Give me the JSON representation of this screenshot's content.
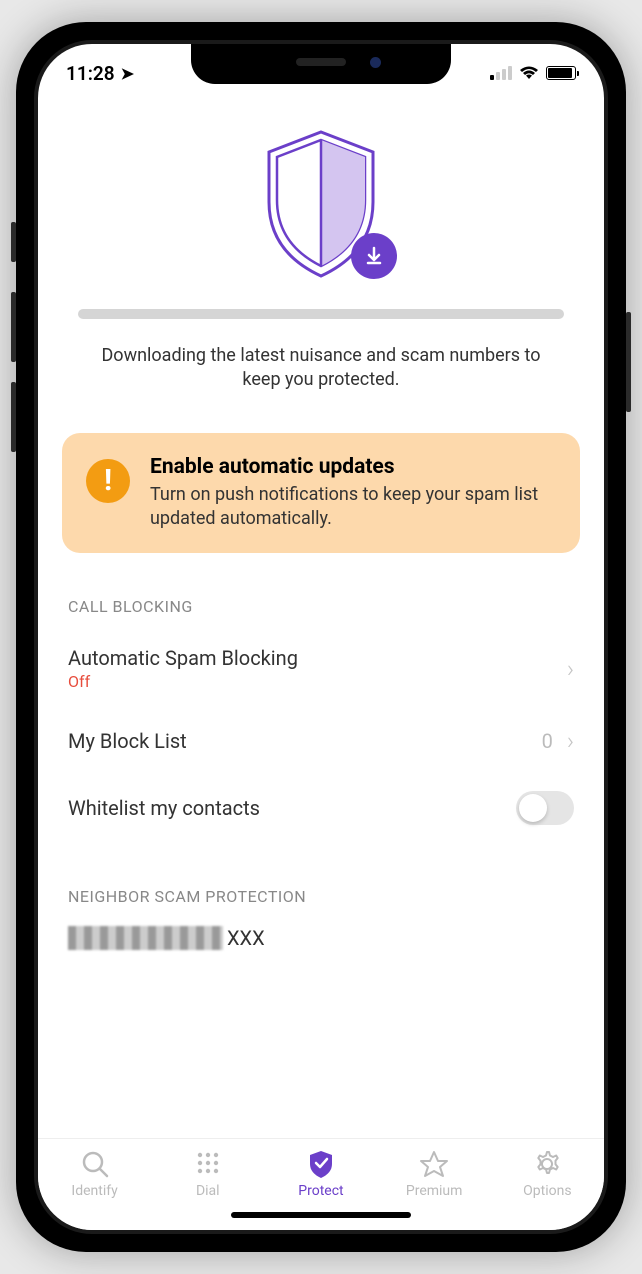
{
  "status": {
    "time": "11:28",
    "location_icon": "➤"
  },
  "hero": {
    "download_text": "Downloading the latest nuisance and scam numbers to keep you protected."
  },
  "alert": {
    "title": "Enable automatic updates",
    "description": "Turn on push notifications to keep your spam list updated automatically.",
    "exclaim": "!"
  },
  "sections": {
    "call_blocking_header": "CALL BLOCKING",
    "neighbor_header": "NEIGHBOR SCAM PROTECTION"
  },
  "rows": {
    "spam_blocking": {
      "label": "Automatic Spam Blocking",
      "status": "Off"
    },
    "block_list": {
      "label": "My Block List",
      "count": "0"
    },
    "whitelist": {
      "label": "Whitelist my contacts"
    },
    "neighbor_suffix": "XXX"
  },
  "tabs": {
    "identify": "Identify",
    "dial": "Dial",
    "protect": "Protect",
    "premium": "Premium",
    "options": "Options"
  }
}
